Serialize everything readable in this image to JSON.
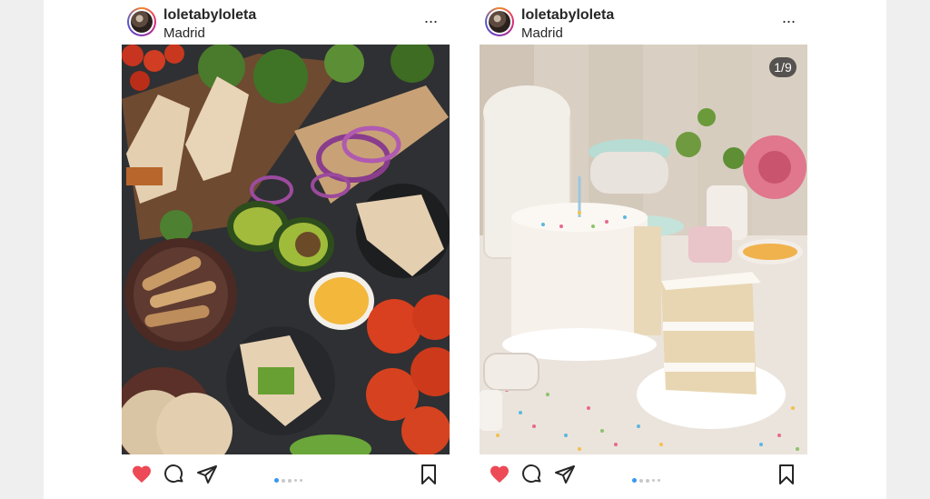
{
  "posts": [
    {
      "username": "loletabyloleta",
      "location": "Madrid",
      "more_label": "...",
      "counter": "",
      "photo": "food-spread-wraps-vegetables",
      "carousel_dots": 5,
      "active_dot": 0,
      "liked": true,
      "icons": [
        "heart-icon",
        "comment-icon",
        "share-icon",
        "bookmark-icon"
      ]
    },
    {
      "username": "loletabyloleta",
      "location": "Madrid",
      "more_label": "...",
      "counter": "1/9",
      "photo": "sprinkle-cake-slice",
      "carousel_dots": 5,
      "active_dot": 0,
      "liked": true,
      "icons": [
        "heart-icon",
        "comment-icon",
        "share-icon",
        "bookmark-icon"
      ]
    }
  ],
  "colors": {
    "like": "#ed4956",
    "active_dot": "#3897f0",
    "text": "#262626"
  }
}
